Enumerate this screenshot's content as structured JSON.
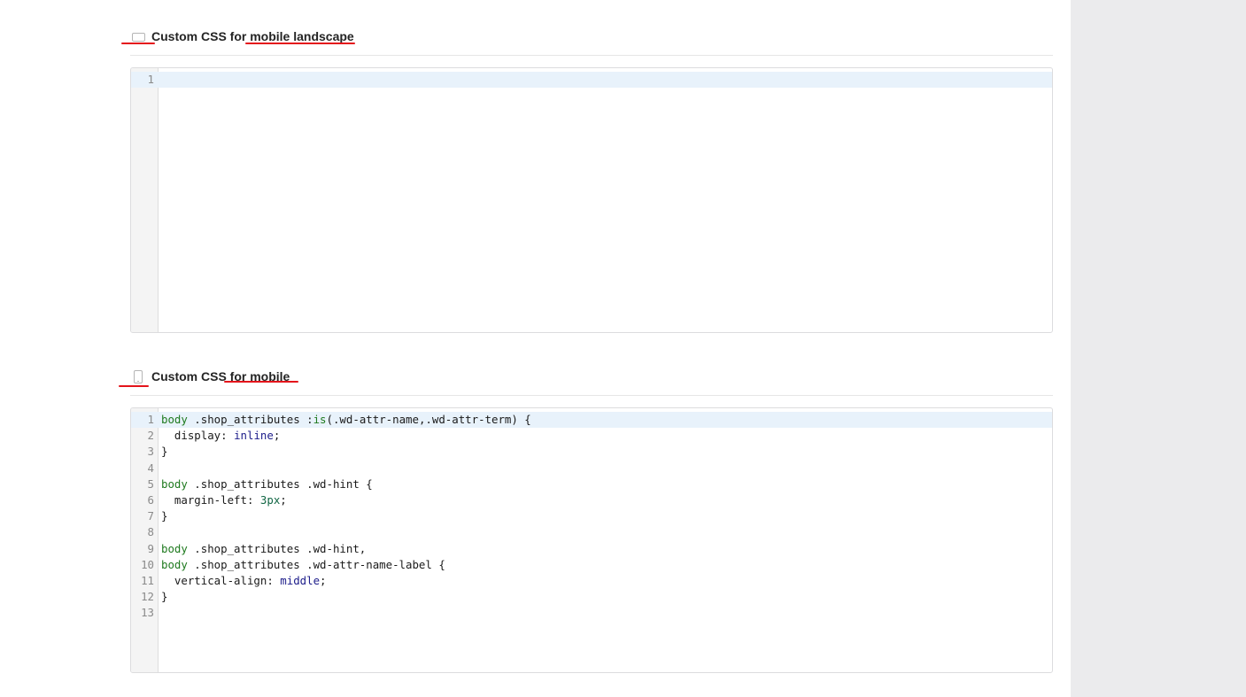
{
  "sections": {
    "landscape": {
      "icon": "mobile-landscape-icon",
      "title": "Custom CSS for mobile landscape",
      "editor": {
        "lines": [
          {
            "n": "1",
            "code": ""
          }
        ]
      }
    },
    "mobile": {
      "icon": "mobile-portrait-icon",
      "title": "Custom CSS for mobile",
      "editor": {
        "lines": [
          {
            "n": "1",
            "code": "body .shop_attributes :is(.wd-attr-name,.wd-attr-term) {"
          },
          {
            "n": "2",
            "code": "  display: inline;"
          },
          {
            "n": "3",
            "code": "}"
          },
          {
            "n": "4",
            "code": ""
          },
          {
            "n": "5",
            "code": "body .shop_attributes .wd-hint {"
          },
          {
            "n": "6",
            "code": "  margin-left: 3px;"
          },
          {
            "n": "7",
            "code": "}"
          },
          {
            "n": "8",
            "code": ""
          },
          {
            "n": "9",
            "code": "body .shop_attributes .wd-hint,"
          },
          {
            "n": "10",
            "code": "body .shop_attributes .wd-attr-name-label {"
          },
          {
            "n": "11",
            "code": "  vertical-align: middle;"
          },
          {
            "n": "12",
            "code": "}"
          },
          {
            "n": "13",
            "code": ""
          }
        ]
      }
    }
  },
  "colors": {
    "annotation": "#e4141b",
    "active_line": "#e8f2fb",
    "sidebar": "#ebebed"
  }
}
